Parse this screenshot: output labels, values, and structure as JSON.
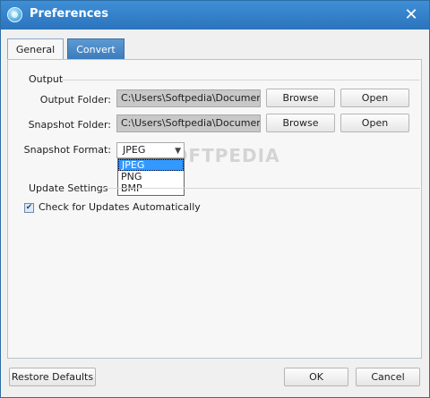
{
  "window": {
    "title": "Preferences"
  },
  "tabs": [
    {
      "label": "General"
    },
    {
      "label": "Convert"
    }
  ],
  "output": {
    "section_label": "Output",
    "output_folder": {
      "label": "Output Folder:",
      "value": "C:\\Users\\Softpedia\\Documents\\"
    },
    "snapshot_folder": {
      "label": "Snapshot Folder:",
      "value": "C:\\Users\\Softpedia\\Documents\\"
    },
    "browse_label": "Browse",
    "open_label": "Open",
    "snapshot_format": {
      "label": "Snapshot Format:",
      "selected": "JPEG",
      "options": [
        "JPEG",
        "PNG",
        "BMP"
      ]
    }
  },
  "update": {
    "section_label": "Update Settings",
    "check_label": "Check for Updates Automatically",
    "checked": true
  },
  "footer": {
    "restore_label": "Restore Defaults",
    "ok_label": "OK",
    "cancel_label": "Cancel"
  },
  "watermark": "SOFTPEDIA",
  "colors": {
    "titlebar": "#2b74bd",
    "tab_inactive": "#3c7bbb",
    "selection": "#3399ff"
  },
  "icons": {
    "close": "close-icon",
    "app": "app-icon",
    "dropdown": "chevron-down-icon",
    "check": "checkmark-icon"
  }
}
